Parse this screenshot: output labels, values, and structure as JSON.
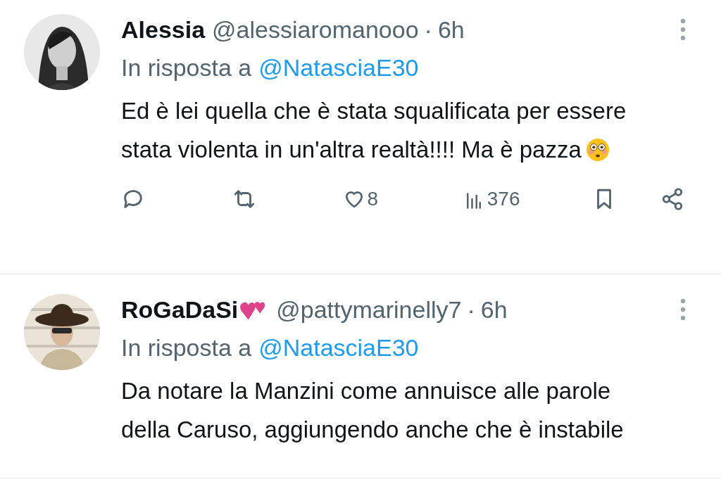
{
  "tweets": [
    {
      "name": "Alessia",
      "name_hearts": false,
      "handle": "@alessiaromanooo",
      "separator": "·",
      "time": "6h",
      "reply_label": "In risposta a",
      "reply_to": "@NatasciaE30",
      "text": "Ed è lei quella che è stata squalificata per essere stata violenta in un'altra realtà!!!! Ma è pazza",
      "flushed_emoji": true,
      "actions": {
        "likes": "8",
        "views": "376"
      }
    },
    {
      "name": "RoGaDaSi",
      "name_hearts": true,
      "handle": "@pattymarinelly7",
      "separator": "·",
      "time": "6h",
      "reply_label": "In risposta a",
      "reply_to": "@NatasciaE30",
      "text": "Da notare la Manzini come annuisce alle parole della Caruso, aggiungendo anche che è instabile",
      "flushed_emoji": false
    }
  ]
}
